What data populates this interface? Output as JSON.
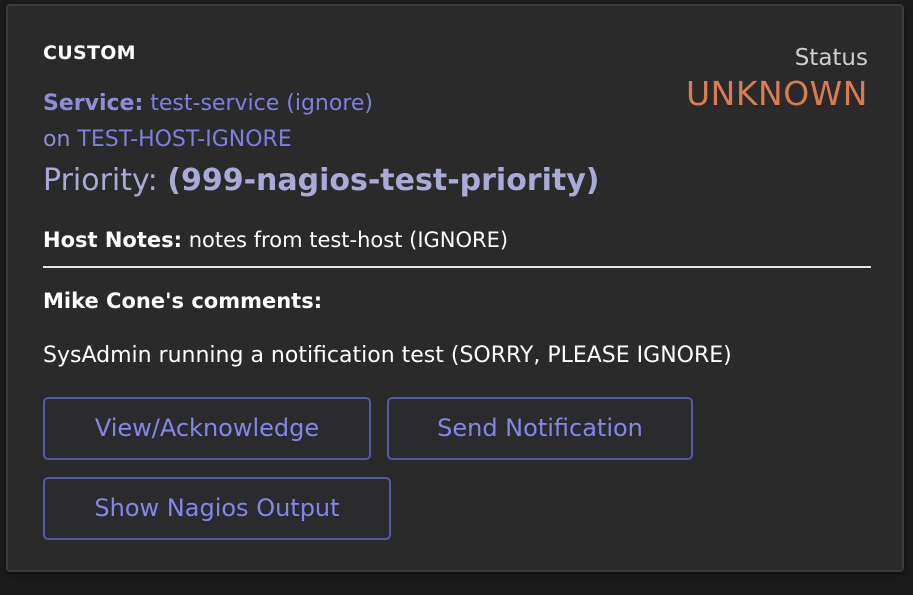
{
  "alert": {
    "type_label": "CUSTOM",
    "status_title": "Status",
    "status_value": "UNKNOWN",
    "service_label": "Service:",
    "service_value": "test-service (ignore)",
    "host_prefix": "on",
    "host_value": "TEST-HOST-IGNORE",
    "priority_label": "Priority:",
    "priority_value": "(999-nagios-test-priority)",
    "host_notes_label": "Host Notes:",
    "host_notes_value": "notes from test-host (IGNORE)",
    "comments_title": "Mike Cone's comments:",
    "comment_text": "SysAdmin running a notification test (SORRY, PLEASE IGNORE)"
  },
  "actions": {
    "view_ack_label": "View/Acknowledge",
    "send_notification_label": "Send Notification",
    "show_output_label": "Show Nagios Output"
  },
  "colors": {
    "background": "#2a2a2b",
    "accent": "#8486e8",
    "status_unknown": "#d97c52",
    "button_border": "#5658a8"
  }
}
